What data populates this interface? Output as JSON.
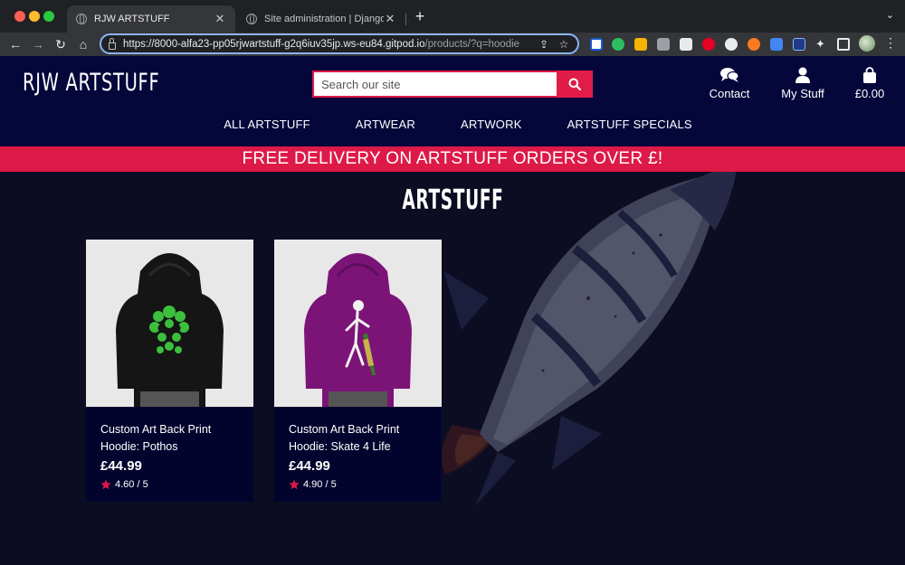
{
  "browser": {
    "tabs": [
      {
        "title": "RJW ARTSTUFF",
        "active": true
      },
      {
        "title": "Site administration | Django site admin",
        "active": false
      }
    ],
    "url_main": "https://8000-alfa23-pp05rjwartstuff-g2q6iuv35jp.ws-eu84.gitpod.io",
    "url_path": "/products/?q=hoodie"
  },
  "site": {
    "logo": "RJW ARTSTUFF",
    "search": {
      "placeholder": "Search our site",
      "value": ""
    },
    "header_links": {
      "contact": "Contact",
      "account": "My Stuff",
      "bag": "£0.00"
    },
    "nav": [
      "ALL ARTSTUFF",
      "ARTWEAR",
      "ARTWORK",
      "ARTSTUFF SPECIALS"
    ],
    "banner": "FREE DELIVERY ON ARTSTUFF ORDERS OVER £!",
    "page_title": "ARTSTUFF",
    "accent": "#dd1a47",
    "navy": "#05063a"
  },
  "products": [
    {
      "name": "Custom Art Back Print Hoodie: Pothos",
      "price": "£44.99",
      "rating": "4.60 / 5",
      "hoodie_color": "#151515",
      "art": "skull-leaf"
    },
    {
      "name": "Custom Art Back Print Hoodie: Skate 4 Life",
      "price": "£44.99",
      "rating": "4.90 / 5",
      "hoodie_color": "#7c1478",
      "art": "skeleton-skate"
    }
  ]
}
